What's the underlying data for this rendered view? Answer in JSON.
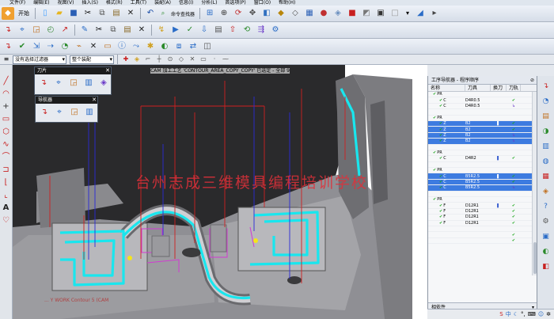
{
  "menu": [
    "文件(F)",
    "编辑(E)",
    "视图(V)",
    "插入(S)",
    "格式(R)",
    "工具(T)",
    "装配(A)",
    "信息(I)",
    "分析(L)",
    "首选项(P)",
    "窗口(O)",
    "帮助(H)"
  ],
  "toolbar": {
    "start_label": "开始",
    "command_finder_label": "命令查找器"
  },
  "selection_bar": {
    "filter_value": "没有选择过滤器",
    "scope_value": "整个装配"
  },
  "viewport": {
    "title": "CAM 加工工艺 'CONTOUR_AREA_COPY_COPY' 已选定 - 全部 9",
    "watermark": "台州志成三维模具编程培训学校",
    "bottom_text": "... Y WORK Contour 5 (CAM"
  },
  "palettes": {
    "tool": {
      "title": "刀片"
    },
    "navigator": {
      "title": "导航器"
    }
  },
  "navigator_panel": {
    "header": "工序导航器 - 程序顺序",
    "columns": [
      "名称",
      "刀具",
      "换刀",
      "刀轨"
    ],
    "rows": [
      {
        "name": "PR",
        "tool": "",
        "change": "",
        "path": "",
        "sel": false,
        "level": 0
      },
      {
        "name": "C",
        "tool": "D4R0.5",
        "change": "",
        "path": "ok",
        "sel": false,
        "level": 1
      },
      {
        "name": "C",
        "tool": "D4R0.5",
        "change": "",
        "path": "flag",
        "sel": false,
        "level": 1
      },
      {
        "name": "",
        "tool": "",
        "change": "",
        "path": "",
        "sel": false,
        "level": 1
      },
      {
        "name": "PR",
        "tool": "",
        "change": "",
        "path": "",
        "sel": false,
        "level": 0
      },
      {
        "name": "Z",
        "tool": "B2",
        "change": "▌",
        "path": "ok",
        "sel": true,
        "level": 1
      },
      {
        "name": "Z",
        "tool": "B2",
        "change": "",
        "path": "ok",
        "sel": true,
        "level": 1
      },
      {
        "name": "Z",
        "tool": "B2",
        "change": "",
        "path": "flag",
        "sel": true,
        "level": 1
      },
      {
        "name": "Z",
        "tool": "B2",
        "change": "",
        "path": "flag",
        "sel": true,
        "level": 1
      },
      {
        "name": "",
        "tool": "",
        "change": "",
        "path": "",
        "sel": false,
        "level": 1
      },
      {
        "name": "PR",
        "tool": "",
        "change": "",
        "path": "",
        "sel": false,
        "level": 0
      },
      {
        "name": "C",
        "tool": "D4R2",
        "change": "▌",
        "path": "ok",
        "sel": false,
        "level": 1
      },
      {
        "name": "",
        "tool": "",
        "change": "",
        "path": "",
        "sel": false,
        "level": 1
      },
      {
        "name": "PR",
        "tool": "",
        "change": "",
        "path": "",
        "sel": false,
        "level": 0
      },
      {
        "name": "C",
        "tool": "B5R2.5",
        "change": "▌",
        "path": "ok",
        "sel": true,
        "level": 1
      },
      {
        "name": "C",
        "tool": "B5R2.5",
        "change": "",
        "path": "ok",
        "sel": true,
        "level": 1
      },
      {
        "name": "C",
        "tool": "B5R2.5",
        "change": "",
        "path": "flag",
        "sel": true,
        "level": 1
      },
      {
        "name": "",
        "tool": "",
        "change": "",
        "path": "",
        "sel": false,
        "level": 1
      },
      {
        "name": "PR",
        "tool": "",
        "change": "",
        "path": "",
        "sel": false,
        "level": 0
      },
      {
        "name": "F",
        "tool": "D12R1",
        "change": "▌",
        "path": "ok",
        "sel": false,
        "level": 1
      },
      {
        "name": "F",
        "tool": "D12R1",
        "change": "",
        "path": "ok",
        "sel": false,
        "level": 1
      },
      {
        "name": "F",
        "tool": "D12R1",
        "change": "",
        "path": "ok",
        "sel": false,
        "level": 1
      },
      {
        "name": "F",
        "tool": "D12R1",
        "change": "",
        "path": "ok",
        "sel": false,
        "level": 1
      },
      {
        "name": "",
        "tool": "",
        "change": "",
        "path": "",
        "sel": false,
        "level": 1
      },
      {
        "name": "",
        "tool": "",
        "change": "",
        "path": "ok",
        "sel": false,
        "level": 1
      },
      {
        "name": "",
        "tool": "",
        "change": "",
        "path": "ok",
        "sel": false,
        "level": 1
      }
    ],
    "dependencies_label": "相依性",
    "details_label": "细节"
  },
  "colors": {
    "toolpath_cyan": "#19e6ee",
    "selection_blue": "#3d7be0",
    "check_green": "#19a519",
    "watermark_red": "#e0303a"
  },
  "icons": {
    "menubar": [
      "nx-logo-icon"
    ],
    "toolbar1": [
      "start-icon",
      "new-icon",
      "open-icon",
      "save-icon",
      "cut-icon",
      "copy-icon",
      "paste-icon",
      "delete-icon",
      "undo-icon",
      "command-finder-icon",
      "fit-icon",
      "zoom-icon",
      "rotate-icon",
      "pan-icon",
      "view-orient-icon",
      "shaded-icon",
      "wireframe-icon",
      "layer-icon",
      "color-icon",
      "render-icon",
      "cube-view-icon",
      "section-icon",
      "display-icon",
      "blank-icon",
      "dropdown-icon"
    ],
    "toolbar2": [
      "create-program-icon",
      "create-tool-icon",
      "create-geometry-icon",
      "create-method-icon",
      "create-operation-icon",
      "edit-object-icon",
      "cut-object-icon",
      "copy-object-icon",
      "paste-object-icon",
      "delete-object-icon",
      "generate-path-icon",
      "replay-icon",
      "verify-icon",
      "postprocess-icon",
      "shop-doc-icon",
      "output-cls-icon",
      "refresh-icon",
      "batch-icon"
    ],
    "toolbar3": [
      "ok-icon",
      "check-icon",
      "reject-icon",
      "feed-icon",
      "speed-icon",
      "cut-method-icon",
      "clear-icon",
      "list-icon",
      "info-icon",
      "display-path-icon",
      "collision-icon",
      "gouge-icon",
      "instance-icon",
      "transform-icon",
      "object-icon"
    ],
    "selection": [
      "menu-icon",
      "snap-icon",
      "point-icon",
      "end-icon",
      "mid-icon",
      "center-icon",
      "quadrant-icon",
      "intersect-icon",
      "face-icon",
      "vertex-icon",
      "curve-icon"
    ],
    "left": [
      "line-icon",
      "arc-icon",
      "plus-icon",
      "rect-icon",
      "polygon-icon",
      "spline-icon",
      "conic-icon",
      "offset-icon",
      "fillet-icon",
      "chamfer-icon",
      "text-icon",
      "heart-icon"
    ],
    "resource": [
      "navigator-icon",
      "history-icon",
      "process-icon",
      "role-icon",
      "palette-icon",
      "web-icon",
      "system-icon",
      "materials-icon",
      "help-icon",
      "tool-library-icon",
      "machine-icon",
      "roles-icon",
      "display-icon",
      "pin-icon"
    ]
  }
}
